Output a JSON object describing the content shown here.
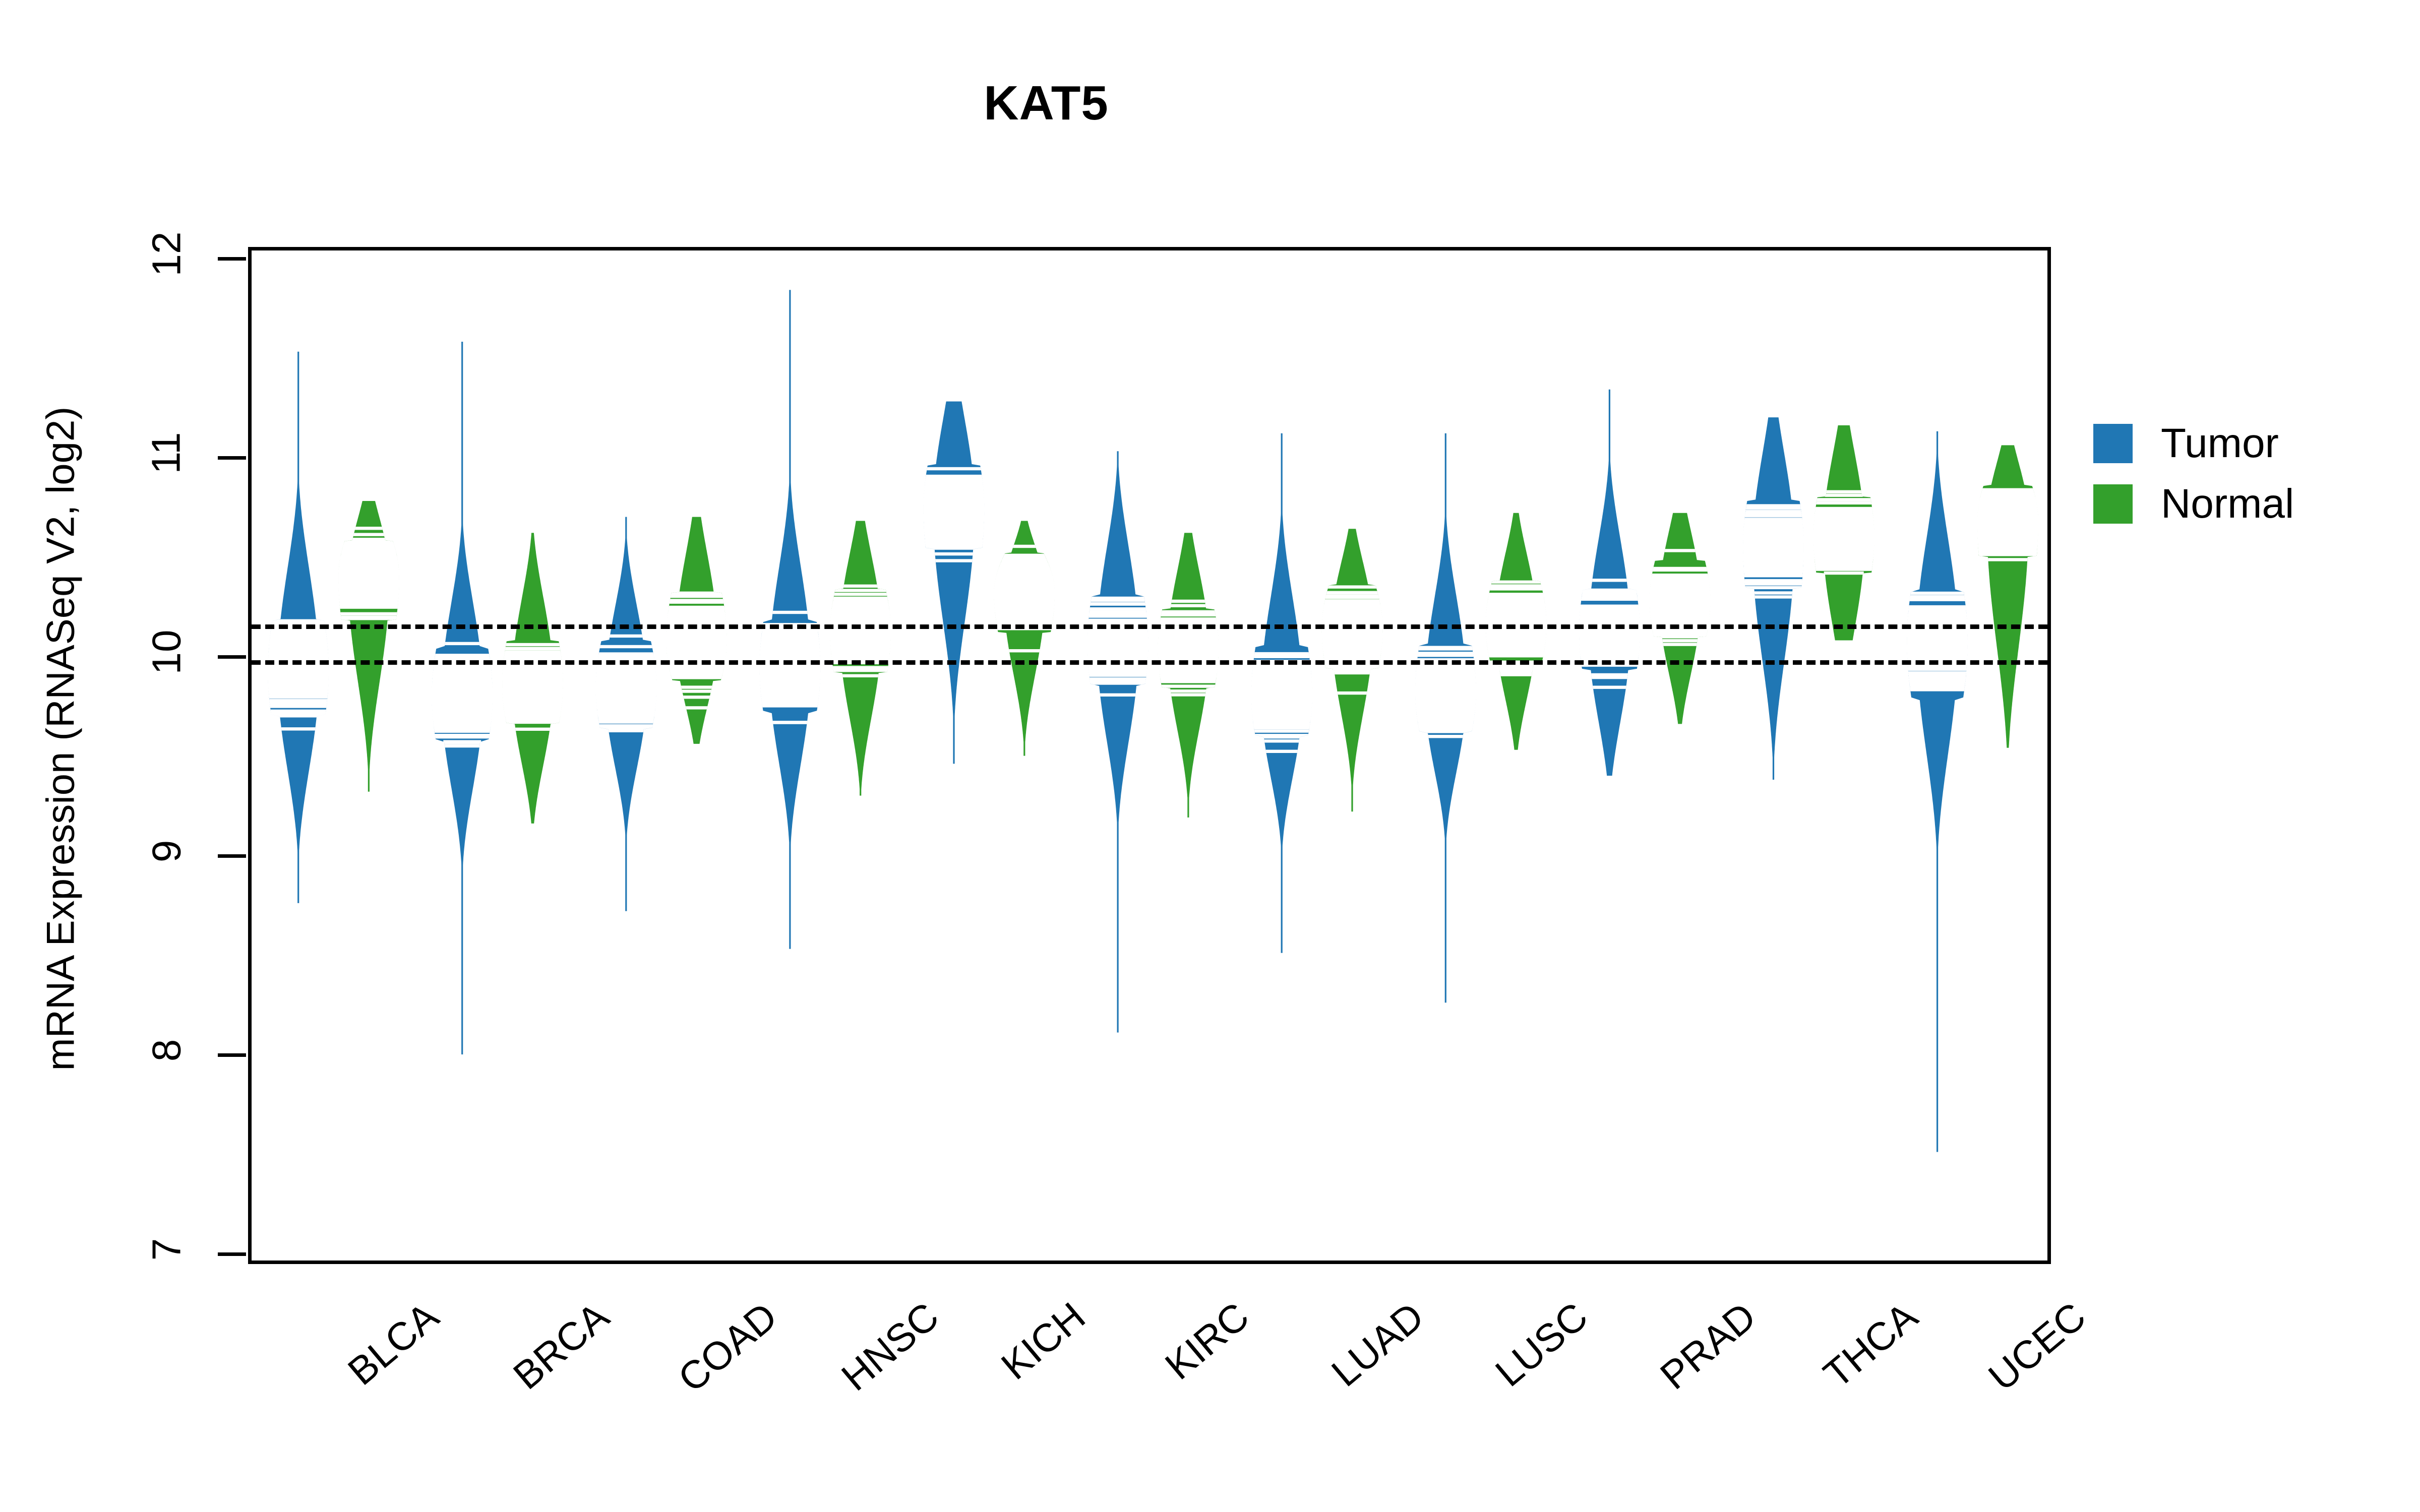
{
  "chart_data": {
    "type": "violin",
    "title": "KAT5",
    "xlabel": "",
    "ylabel": "mRNA Expression (RNASeq V2, log2)",
    "ylim": [
      7,
      12
    ],
    "yticks": [
      7,
      8,
      9,
      10,
      11,
      12
    ],
    "ytick_labels": [
      "7",
      "8",
      "9",
      "10",
      "11",
      "12"
    ],
    "grid": false,
    "legend_position": "right",
    "reference_lines": [
      10.18,
      10.0
    ],
    "categories": [
      "BLCA",
      "BRCA",
      "COAD",
      "HNSC",
      "KICH",
      "KIRC",
      "LUAD",
      "LUSC",
      "PRAD",
      "THCA",
      "UCEC"
    ],
    "legend": [
      {
        "name": "Tumor",
        "color": "#2077B4"
      },
      {
        "name": "Normal",
        "color": "#33A02C"
      }
    ],
    "series": [
      {
        "name": "Tumor",
        "color": "#2077B4",
        "groups": [
          {
            "category": "BLCA",
            "median": 9.94,
            "q1": 9.72,
            "q3": 10.2,
            "min": 8.78,
            "max": 11.55,
            "density_lo": 9.44,
            "density_hi": 10.47
          },
          {
            "category": "BRCA",
            "median": 9.82,
            "q1": 9.6,
            "q3": 10.07,
            "min": 8.02,
            "max": 11.6,
            "density_lo": 9.35,
            "density_hi": 10.3
          },
          {
            "category": "COAD",
            "median": 9.86,
            "q1": 9.66,
            "q3": 10.1,
            "min": 8.74,
            "max": 10.72,
            "density_lo": 9.45,
            "density_hi": 10.28
          },
          {
            "category": "HNSC",
            "median": 9.96,
            "q1": 9.74,
            "q3": 10.2,
            "min": 8.55,
            "max": 11.86,
            "density_lo": 9.47,
            "density_hi": 10.48
          },
          {
            "category": "KICH",
            "median": 10.76,
            "q1": 10.56,
            "q3": 10.98,
            "min": 9.48,
            "max": 11.3,
            "density_lo": 10.18,
            "density_hi": 11.22
          },
          {
            "category": "KIRC",
            "median": 10.08,
            "q1": 9.88,
            "q3": 10.32,
            "min": 8.13,
            "max": 11.05,
            "density_lo": 9.58,
            "density_hi": 10.58
          },
          {
            "category": "LUAD",
            "median": 9.82,
            "q1": 9.62,
            "q3": 10.07,
            "min": 8.53,
            "max": 11.14,
            "density_lo": 9.4,
            "density_hi": 10.33
          },
          {
            "category": "LUSC",
            "median": 9.84,
            "q1": 9.64,
            "q3": 10.08,
            "min": 8.28,
            "max": 11.14,
            "density_lo": 9.43,
            "density_hi": 10.33
          },
          {
            "category": "PRAD",
            "median": 10.14,
            "q1": 9.95,
            "q3": 10.36,
            "min": 9.42,
            "max": 11.36,
            "density_lo": 9.68,
            "density_hi": 10.62
          },
          {
            "category": "THCA",
            "median": 10.57,
            "q1": 10.36,
            "q3": 10.8,
            "min": 9.4,
            "max": 11.22,
            "density_lo": 9.98,
            "density_hi": 11.05
          },
          {
            "category": "UCEC",
            "median": 10.1,
            "q1": 9.8,
            "q3": 10.35,
            "min": 7.53,
            "max": 11.15,
            "density_lo": 9.52,
            "density_hi": 10.62
          }
        ]
      },
      {
        "name": "Normal",
        "color": "#33A02C",
        "groups": [
          {
            "category": "BLCA",
            "median": 10.42,
            "q1": 10.2,
            "q3": 10.6,
            "min": 9.34,
            "max": 10.8,
            "density_lo": 9.88,
            "density_hi": 10.72
          },
          {
            "category": "BRCA",
            "median": 9.88,
            "q1": 9.68,
            "q3": 10.1,
            "min": 9.18,
            "max": 10.64,
            "density_lo": 9.47,
            "density_hi": 10.32
          },
          {
            "category": "COAD",
            "median": 10.1,
            "q1": 9.9,
            "q3": 10.34,
            "min": 9.58,
            "max": 10.72,
            "density_lo": 9.76,
            "density_hi": 10.54
          },
          {
            "category": "HNSC",
            "median": 10.14,
            "q1": 9.94,
            "q3": 10.36,
            "min": 9.32,
            "max": 10.7,
            "density_lo": 9.7,
            "density_hi": 10.54
          },
          {
            "category": "KICH",
            "median": 10.34,
            "q1": 10.14,
            "q3": 10.54,
            "min": 9.52,
            "max": 10.7,
            "density_lo": 9.92,
            "density_hi": 10.58
          },
          {
            "category": "KIRC",
            "median": 10.06,
            "q1": 9.86,
            "q3": 10.26,
            "min": 9.21,
            "max": 10.64,
            "density_lo": 9.64,
            "density_hi": 10.46
          },
          {
            "category": "LUAD",
            "median": 10.16,
            "q1": 9.96,
            "q3": 10.38,
            "min": 9.24,
            "max": 10.66,
            "density_lo": 9.72,
            "density_hi": 10.5
          },
          {
            "category": "LUSC",
            "median": 10.18,
            "q1": 9.98,
            "q3": 10.4,
            "min": 9.55,
            "max": 10.74,
            "density_lo": 9.8,
            "density_hi": 10.54
          },
          {
            "category": "PRAD",
            "median": 10.3,
            "q1": 10.12,
            "q3": 10.5,
            "min": 9.68,
            "max": 10.74,
            "density_lo": 9.92,
            "density_hi": 10.66
          },
          {
            "category": "THCA",
            "median": 10.62,
            "q1": 10.44,
            "q3": 10.82,
            "min": 10.1,
            "max": 11.18,
            "density_lo": 10.15,
            "density_hi": 11.05
          },
          {
            "category": "UCEC",
            "median": 10.7,
            "q1": 10.52,
            "q3": 10.88,
            "min": 9.56,
            "max": 11.08,
            "density_lo": 10.05,
            "density_hi": 11.0
          }
        ]
      }
    ]
  }
}
